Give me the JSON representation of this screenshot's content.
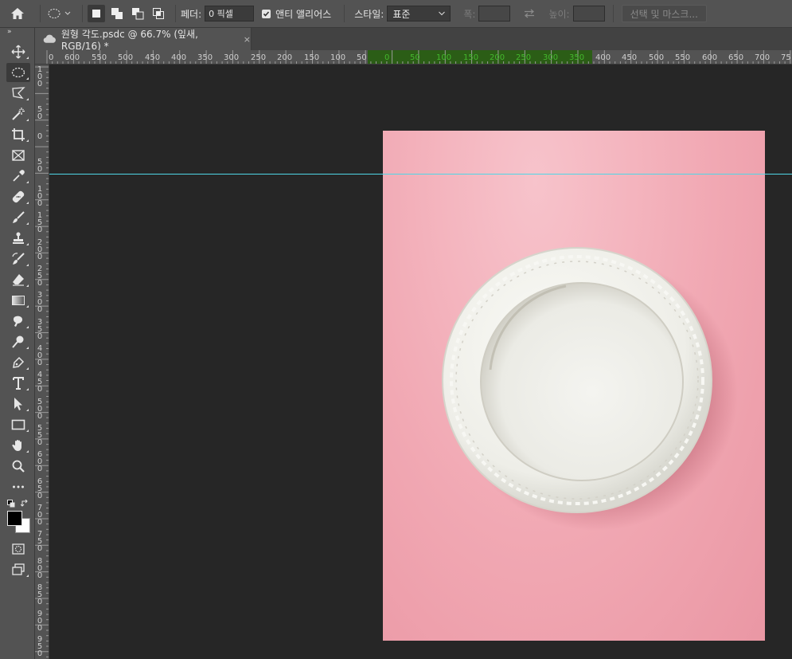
{
  "options_bar": {
    "feather_label": "페더:",
    "feather_value": "0 픽셀",
    "antialias_label": "앤티 앨리어스",
    "style_label": "스타일:",
    "style_value": "표준",
    "width_label": "폭:",
    "height_label": "높이:",
    "select_mask_label": "선택 및 마스크..."
  },
  "document_tab": {
    "title": "원형 각도.psdc @ 66.7% (잎새, RGB/16) *",
    "close_label": "×"
  },
  "toolbar": {
    "collapse_label": "»"
  },
  "horizontal_ruler": {
    "labels": [
      "0",
      "600",
      "550",
      "500",
      "450",
      "400",
      "350",
      "300",
      "250",
      "200",
      "150",
      "100",
      "50",
      "0",
      "50",
      "100",
      "150",
      "200",
      "250",
      "300",
      "350",
      "400",
      "450",
      "500",
      "550",
      "600",
      "650",
      "700",
      "75"
    ]
  },
  "vertical_ruler": {
    "labels": [
      "1 0 0",
      "5 0",
      "0",
      "5 0",
      "1 0 0",
      "1 5 0",
      "2 0 0",
      "2 5 0",
      "3 0 0",
      "3 5 0",
      "4 0 0",
      "4 5 0",
      "5 0 0",
      "5 5 0",
      "6 0 0",
      "6 5 0",
      "7 0 0",
      "7 5 0",
      "8 0 0",
      "8 5 0",
      "9 0 0",
      "9 5 0"
    ]
  },
  "colors": {
    "foreground": "#000000",
    "background": "#ffffff",
    "guide": "#4fd7e6",
    "ruler_highlight": "#2b5d16"
  }
}
